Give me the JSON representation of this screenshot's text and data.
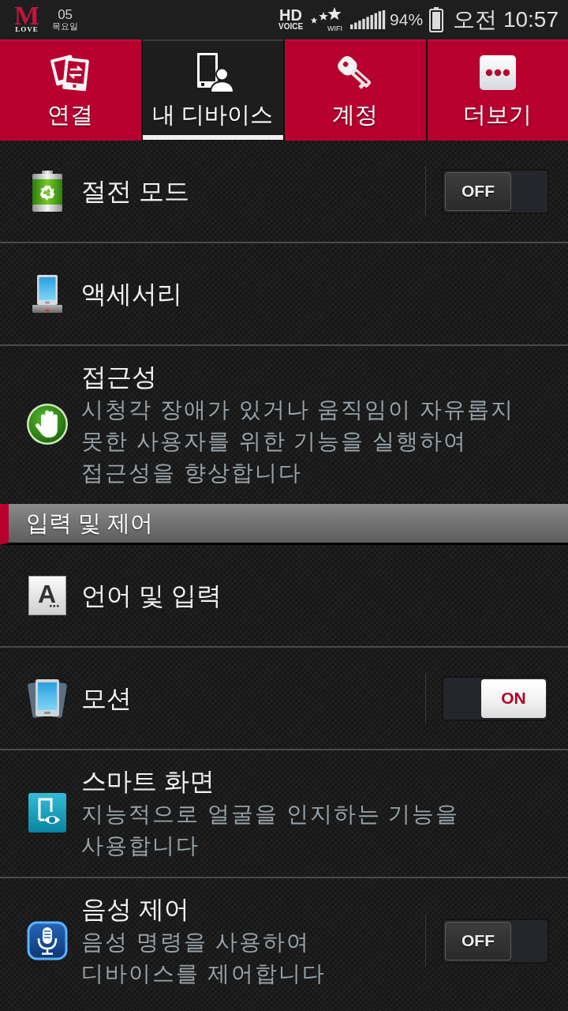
{
  "status_bar": {
    "logo": {
      "letter": "M",
      "caption": "LOVE"
    },
    "day": "05",
    "weekday": "목요일",
    "hd_voice": [
      "HD",
      "VOICE"
    ],
    "wifi_label": "WIFI",
    "battery": "94%",
    "time": "오전 10:57"
  },
  "tabs": [
    {
      "label": "연결",
      "selected": false
    },
    {
      "label": "내 디바이스",
      "selected": true
    },
    {
      "label": "계정",
      "selected": false
    },
    {
      "label": "더보기",
      "selected": false
    }
  ],
  "rows": [
    {
      "kind": "switch",
      "title": "절전 모드",
      "on": false,
      "switch_label": "OFF"
    },
    {
      "kind": "item",
      "title": "액세서리"
    },
    {
      "kind": "item",
      "title": "접근성",
      "description": "시청각 장애가 있거나 움직임이 자유롭지 못한 사용자를 위한 기능을 실행하여 접근성을 향상합니다"
    },
    {
      "kind": "header",
      "title": "입력 및 제어"
    },
    {
      "kind": "item",
      "title": "언어 및 입력",
      "icon_letter": "A"
    },
    {
      "kind": "switch",
      "title": "모션",
      "on": true,
      "switch_label": "ON"
    },
    {
      "kind": "item",
      "title": "스마트 화면",
      "description": "지능적으로 얼굴을 인지하는 기능을 사용합니다"
    },
    {
      "kind": "switch",
      "title": "음성 제어",
      "description": "음성 명령을 사용하여 디바이스를 제어합니다",
      "on": false,
      "switch_label": "OFF"
    }
  ]
}
